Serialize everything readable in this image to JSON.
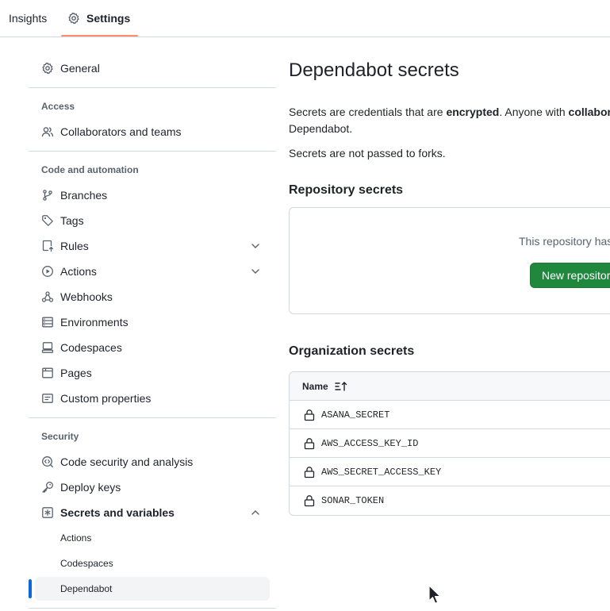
{
  "top_tabs": {
    "insights": "Insights",
    "settings": "Settings"
  },
  "sidebar": {
    "general": "General",
    "access_title": "Access",
    "collaborators": "Collaborators and teams",
    "code_title": "Code and automation",
    "branches": "Branches",
    "tags": "Tags",
    "rules": "Rules",
    "actions": "Actions",
    "webhooks": "Webhooks",
    "environments": "Environments",
    "codespaces": "Codespaces",
    "pages": "Pages",
    "custom_properties": "Custom properties",
    "security_title": "Security",
    "code_security": "Code security and analysis",
    "deploy_keys": "Deploy keys",
    "secrets_vars": "Secrets and variables",
    "sub_actions": "Actions",
    "sub_codespaces": "Codespaces",
    "sub_dependabot": "Dependabot"
  },
  "main": {
    "title": "Dependabot secrets",
    "desc_part1": "Secrets are credentials that are ",
    "desc_bold1": "encrypted",
    "desc_part2": ". Anyone with ",
    "desc_bold2": "collabor",
    "desc_line2": "Dependabot.",
    "forks_note": "Secrets are not passed to forks.",
    "repo_secrets_title": "Repository secrets",
    "repo_empty_text": "This repository has",
    "new_repo_button": "New repository",
    "org_secrets_title": "Organization secrets",
    "table_header_name": "Name",
    "org_secrets": [
      "ASANA_SECRET",
      "AWS_ACCESS_KEY_ID",
      "AWS_SECRET_ACCESS_KEY",
      "SONAR_TOKEN"
    ]
  },
  "colors": {
    "accent": "#0969da",
    "button_green": "#1f883d",
    "tab_underline": "#fd8c73"
  }
}
